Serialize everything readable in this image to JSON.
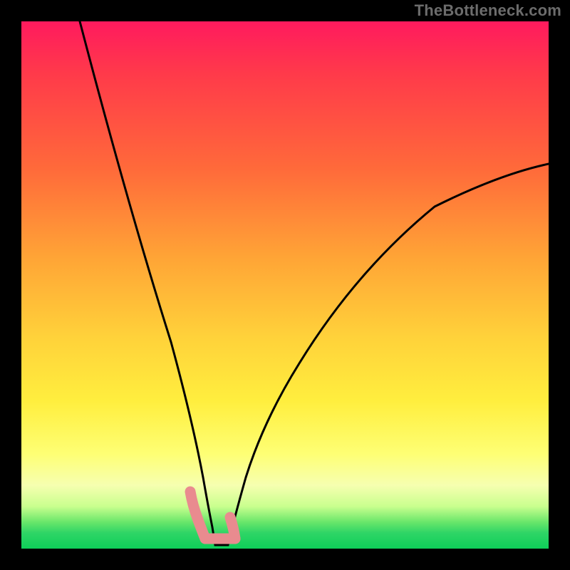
{
  "watermark": "TheBottleneck.com",
  "chart_data": {
    "type": "line",
    "title": "",
    "xlabel": "",
    "ylabel": "",
    "xlim": [
      0,
      100
    ],
    "ylim": [
      0,
      100
    ],
    "grid": false,
    "legend": false,
    "note": "Black V-shaped curve over a red→green vertical gradient. No tick labels are rendered; values are approximate proportions read from pixel positions (0–100 range).",
    "gradient_stops": [
      {
        "pos": 0,
        "color": "#ff1a5e"
      },
      {
        "pos": 10,
        "color": "#ff3a4a"
      },
      {
        "pos": 28,
        "color": "#ff6a3a"
      },
      {
        "pos": 45,
        "color": "#ffa536"
      },
      {
        "pos": 60,
        "color": "#ffd23a"
      },
      {
        "pos": 72,
        "color": "#ffee3e"
      },
      {
        "pos": 82,
        "color": "#feff74"
      },
      {
        "pos": 88,
        "color": "#f6ffb0"
      },
      {
        "pos": 92,
        "color": "#c9ff8e"
      },
      {
        "pos": 95,
        "color": "#68e66a"
      },
      {
        "pos": 97,
        "color": "#2fd566"
      },
      {
        "pos": 100,
        "color": "#0ecf59"
      }
    ],
    "series": [
      {
        "name": "left-branch",
        "color": "#000000",
        "x": [
          11,
          14,
          17,
          20,
          23,
          26,
          28,
          30,
          32,
          33.5,
          35
        ],
        "y": [
          100,
          86,
          72,
          58,
          45,
          33,
          25,
          18,
          12,
          8,
          4
        ]
      },
      {
        "name": "right-branch",
        "color": "#000000",
        "x": [
          39,
          41,
          44,
          48,
          52,
          57,
          63,
          70,
          78,
          86,
          94,
          100
        ],
        "y": [
          4,
          8,
          14,
          21,
          28,
          35,
          43,
          51,
          58,
          64,
          69,
          73
        ]
      }
    ],
    "annotations": [
      {
        "name": "valley-marker",
        "color": "#e98b8f",
        "shape": "rounded path forming a small V at the minimum",
        "x_range": [
          32,
          40.5
        ],
        "y_range": [
          0.5,
          10
        ]
      }
    ],
    "valley_x": 37
  }
}
